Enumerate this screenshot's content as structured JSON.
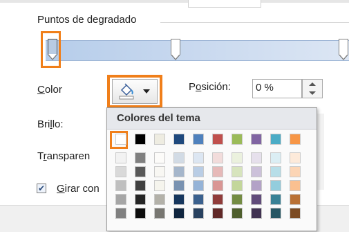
{
  "section": {
    "title": "Puntos de degradado"
  },
  "labels": {
    "color": "Color",
    "brillo": "Brillo:",
    "transparencia": "Transparen",
    "posicion": "Posición:",
    "girar": "Girar con"
  },
  "posicion": {
    "value": "0 %"
  },
  "checkbox": {
    "checked": true,
    "mark": "✔"
  },
  "panel": {
    "title": "Colores del tema"
  },
  "colors": {
    "accent": "#f07f1a",
    "theme_top": [
      "#ffffff",
      "#000000",
      "#eeece1",
      "#1f497d",
      "#4f81bd",
      "#c0504d",
      "#9bbb59",
      "#8064a2",
      "#4bacc6",
      "#f79646"
    ]
  },
  "icons": {
    "color_button": "paint-bucket-icon",
    "dropdown": "chevron-down-icon"
  }
}
